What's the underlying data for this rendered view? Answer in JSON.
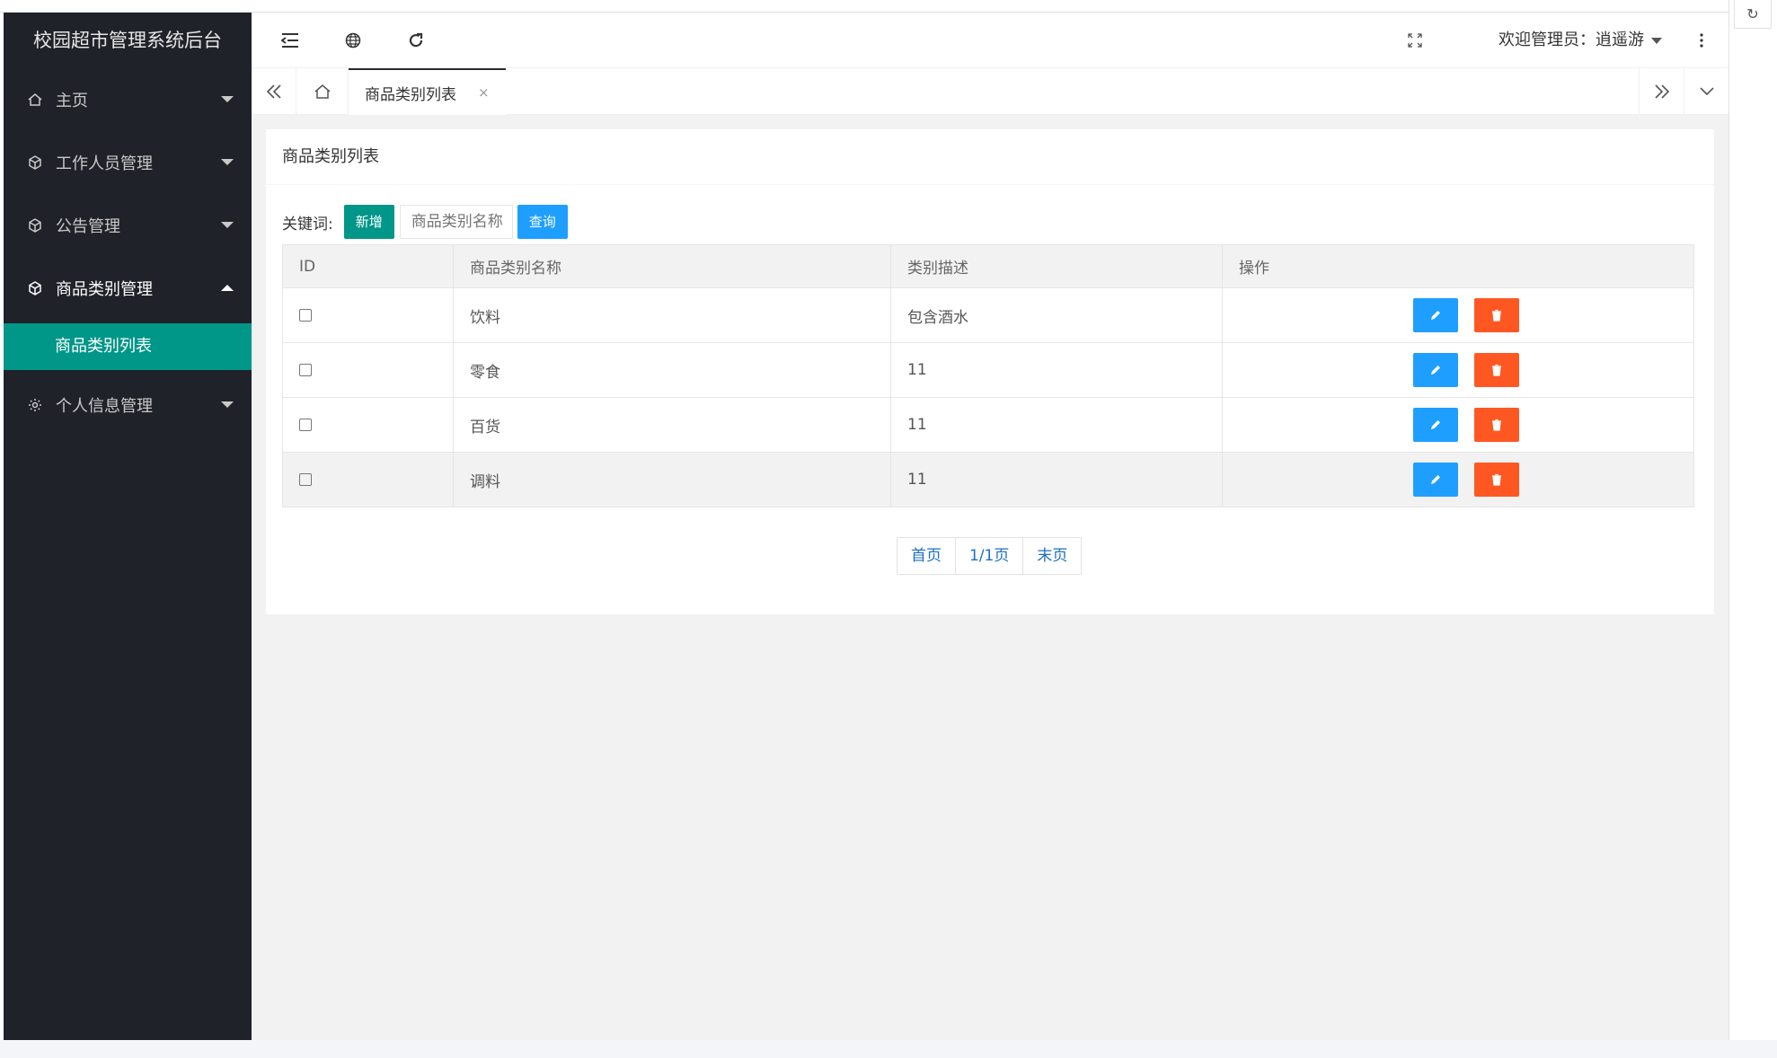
{
  "app": {
    "brand": "校园超市管理系统后台"
  },
  "sidebar": {
    "items": [
      {
        "label": "主页",
        "icon": "home-icon"
      },
      {
        "label": "工作人员管理",
        "icon": "cube-icon"
      },
      {
        "label": "公告管理",
        "icon": "cube-icon"
      },
      {
        "label": "商品类别管理",
        "icon": "cube-icon",
        "expanded": true,
        "children": [
          {
            "label": "商品类别列表",
            "selected": true
          }
        ]
      },
      {
        "label": "个人信息管理",
        "icon": "gear-icon"
      }
    ]
  },
  "header": {
    "welcome": "欢迎管理员：逍遥游",
    "icons": [
      "menu-fold-icon",
      "globe-icon",
      "refresh-icon",
      "fullscreen-icon",
      "more-vertical-icon"
    ]
  },
  "tabs": {
    "active": "商品类别列表",
    "close": "×"
  },
  "card": {
    "title": "商品类别列表"
  },
  "toolbar": {
    "keyword_label": "关键词:",
    "add_label": "新增",
    "search_placeholder": "商品类别名称",
    "query_label": "查询"
  },
  "table": {
    "headers": [
      "ID",
      "商品类别名称",
      "类别描述",
      "操作"
    ],
    "rows": [
      {
        "name": "饮料",
        "desc": "包含酒水"
      },
      {
        "name": "零食",
        "desc": "11"
      },
      {
        "name": "百货",
        "desc": "11"
      },
      {
        "name": "调料",
        "desc": "11"
      }
    ]
  },
  "pager": {
    "first": "首页",
    "current": "1/1页",
    "last": "末页"
  },
  "colors": {
    "sidebar": "#20222a",
    "accent": "#009688",
    "primary": "#1e9fff",
    "danger": "#ff5722"
  }
}
